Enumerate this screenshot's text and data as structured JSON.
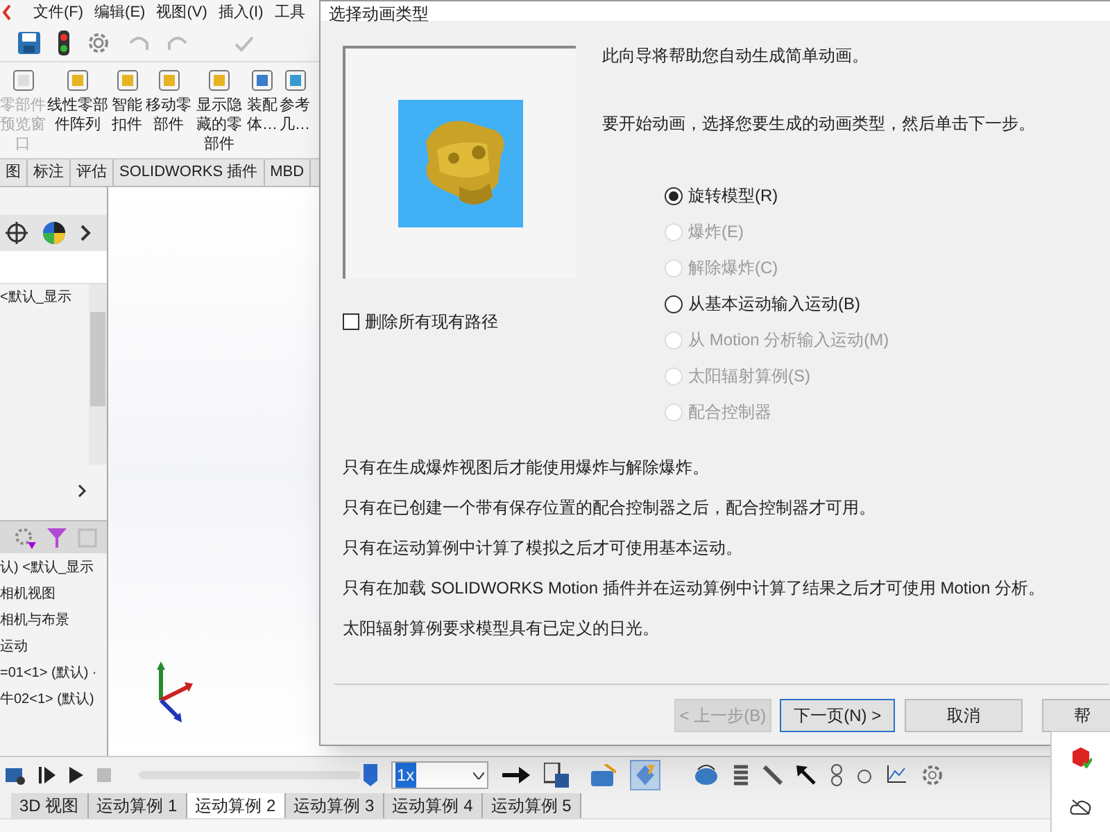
{
  "menu_bar": [
    "文件(F)",
    "编辑(E)",
    "视图(V)",
    "插入(I)",
    "工具"
  ],
  "command_manager": [
    {
      "label": "零部件预览窗口",
      "disabled": true
    },
    {
      "label": "线性零部件阵列",
      "disabled": false
    },
    {
      "label": "智能扣件",
      "disabled": false
    },
    {
      "label": "移动零部件",
      "disabled": false
    },
    {
      "label": "显示隐藏的零部件",
      "disabled": false
    },
    {
      "label": "装配体…",
      "disabled": false
    },
    {
      "label": "参考几…",
      "disabled": false
    }
  ],
  "ribbon_tabs": [
    {
      "label": "图",
      "selected": false
    },
    {
      "label": "标注",
      "selected": false
    },
    {
      "label": "评估",
      "selected": false
    },
    {
      "label": "SOLIDWORKS 插件",
      "selected": false
    },
    {
      "label": "MBD",
      "selected": false
    }
  ],
  "feature_tree": {
    "top_item": "<默认_显示",
    "items": [
      "认) <默认_显示",
      "相机视图",
      "相机与布景",
      "运动",
      "=01<1> (默认) ·",
      "牛02<1> (默认)"
    ]
  },
  "motion_toolbar": {
    "speed": "1x"
  },
  "study_tabs": [
    {
      "label": "3D 视图",
      "selected": false
    },
    {
      "label": "运动算例 1",
      "selected": false
    },
    {
      "label": "运动算例 2",
      "selected": true
    },
    {
      "label": "运动算例 3",
      "selected": false
    },
    {
      "label": "运动算例 4",
      "selected": false
    },
    {
      "label": "运动算例 5",
      "selected": false
    }
  ],
  "dialog": {
    "title": "选择动画类型",
    "intro": [
      "此向导将帮助您自动生成简单动画。",
      "要开始动画，选择您要生成的动画类型，然后单击下一步。"
    ],
    "delete_paths": {
      "label": "删除所有现有路径",
      "checked": false
    },
    "options": [
      {
        "label": "旋转模型(R)",
        "selected": true,
        "disabled": false
      },
      {
        "label": "爆炸(E)",
        "selected": false,
        "disabled": true
      },
      {
        "label": "解除爆炸(C)",
        "selected": false,
        "disabled": true
      },
      {
        "label": "从基本运动输入运动(B)",
        "selected": false,
        "disabled": false
      },
      {
        "label": "从 Motion 分析输入运动(M)",
        "selected": false,
        "disabled": true
      },
      {
        "label": "太阳辐射算例(S)",
        "selected": false,
        "disabled": true
      },
      {
        "label": "配合控制器",
        "selected": false,
        "disabled": true
      }
    ],
    "notes": [
      "只有在生成爆炸视图后才能使用爆炸与解除爆炸。",
      "只有在已创建一个带有保存位置的配合控制器之后，配合控制器才可用。",
      "只有在运动算例中计算了模拟之后才可使用基本运动。",
      "只有在加载 SOLIDWORKS Motion 插件并在运动算例中计算了结果之后才可使用 Motion 分析。",
      "太阳辐射算例要求模型具有已定义的日光。"
    ],
    "buttons": [
      {
        "label": "< 上一步(B)",
        "disabled": true,
        "default": false
      },
      {
        "label": "下一页(N) >",
        "disabled": false,
        "default": true
      },
      {
        "label": "取消",
        "disabled": false,
        "default": false
      },
      {
        "label": "帮",
        "disabled": false,
        "default": false
      }
    ]
  }
}
